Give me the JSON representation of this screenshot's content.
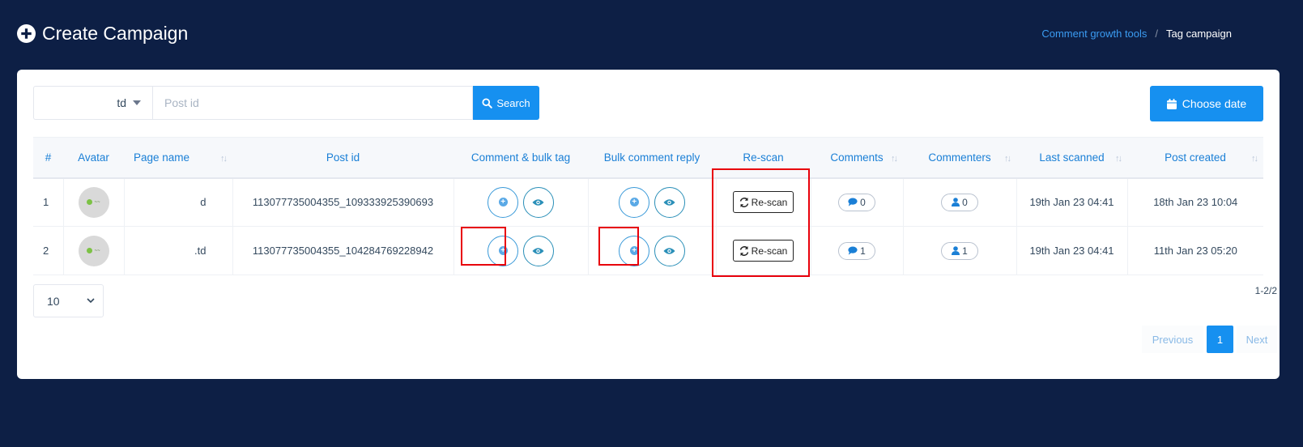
{
  "header": {
    "title": "Create Campaign",
    "breadcrumb": {
      "parent": "Comment growth tools",
      "separator": "/",
      "current": "Tag campaign"
    }
  },
  "toolbar": {
    "page_select_value": "td",
    "post_input_placeholder": "Post id",
    "search_label": "Search",
    "choose_date_label": "Choose date"
  },
  "table": {
    "columns": [
      "#",
      "Avatar",
      "Page name",
      "Post id",
      "Comment & bulk tag",
      "Bulk comment reply",
      "Re-scan",
      "Comments",
      "Commenters",
      "Last scanned",
      "Post created"
    ],
    "rows": [
      {
        "index": "1",
        "page_name": "d",
        "post_id": "113077735004355_109333925390693",
        "rescan_label": "Re-scan",
        "comments": "0",
        "commenters": "0",
        "last_scanned": "19th Jan 23 04:41",
        "post_created": "18th Jan 23 10:04"
      },
      {
        "index": "2",
        "page_name": ".td",
        "post_id": "113077735004355_104284769228942",
        "rescan_label": "Re-scan",
        "comments": "1",
        "commenters": "1",
        "last_scanned": "19th Jan 23 04:41",
        "post_created": "11th Jan 23 05:20"
      }
    ]
  },
  "footer": {
    "page_length": "10",
    "range_info": "1-2/2",
    "pagination": {
      "previous": "Previous",
      "current_page": "1",
      "next": "Next"
    }
  },
  "colors": {
    "background": "#0d1f45",
    "primary": "#1690f0",
    "highlight": "#e8000b"
  },
  "icons": [
    "plus-circle-icon",
    "search-icon",
    "calendar-icon",
    "plus-icon",
    "eye-icon",
    "refresh-icon",
    "comment-icon",
    "user-icon",
    "chevron-down-icon"
  ]
}
